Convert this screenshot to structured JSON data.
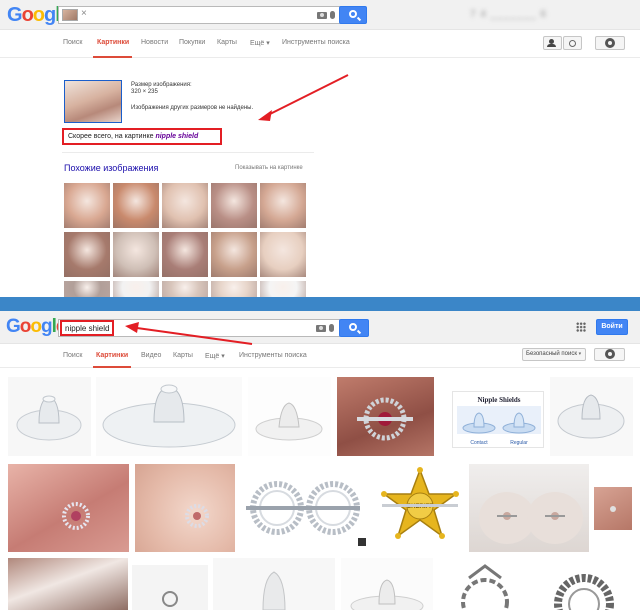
{
  "colors": {
    "g_blue": "#4285f4",
    "g_red": "#ea4335",
    "g_yellow": "#fbbc05",
    "g_green": "#34a853",
    "active_tab": "#dd4b39",
    "annotation_red": "#e31e24",
    "separator_blue": "#3b86c8",
    "link_blue": "#1a0dab",
    "visited_purple": "#660099"
  },
  "logo": {
    "letters": [
      "G",
      "o",
      "o",
      "g",
      "l",
      "e"
    ]
  },
  "top": {
    "chip_close": "×",
    "blurred_user": "7  4  _______  6",
    "nav": [
      {
        "label": "Поиск",
        "active": false
      },
      {
        "label": "Картинки",
        "active": true
      },
      {
        "label": "Новости",
        "active": false
      },
      {
        "label": "Покупки",
        "active": false
      },
      {
        "label": "Карты",
        "active": false
      },
      {
        "label": "Ещё ▾",
        "active": false
      },
      {
        "label": "Инструменты поиска",
        "active": false
      }
    ],
    "info": {
      "size_label": "Размер изображения:",
      "size_value": "320 × 235",
      "other_sizes": "Изображения других размеров не найдены."
    },
    "best_guess_prefix": "Скорее всего, на картинке",
    "best_guess_query": "nipple shield",
    "similar_title": "Похожие изображения",
    "similar_link": "Показывать на картинке",
    "grid_colors": [
      [
        "#d9a892",
        "#c98a6d",
        "#e0c1b0",
        "#b98f86",
        "#d4a894"
      ],
      [
        "#a67a6c",
        "#cfbfb6",
        "#a97e77",
        "#c7a08b",
        "#e7cfc0"
      ],
      [
        "#7d5f55",
        "#eaeaea",
        "#bfa08f",
        "#d7b9a6",
        "#eeeeee"
      ]
    ]
  },
  "bottom": {
    "query": "nipple shield",
    "nav": [
      {
        "label": "Поиск",
        "active": false
      },
      {
        "label": "Картинки",
        "active": true
      },
      {
        "label": "Видео",
        "active": false
      },
      {
        "label": "Карты",
        "active": false
      },
      {
        "label": "Ещё ▾",
        "active": false
      },
      {
        "label": "Инструменты поиска",
        "active": false
      }
    ],
    "signin": "Войти",
    "safe_search": "Безопасный поиск",
    "caret": "▾",
    "nipple_card_title": "Nipple Shields",
    "nipple_card_labels": [
      "Contact",
      "Regular"
    ],
    "sheriff_text": "SHERIFF"
  }
}
